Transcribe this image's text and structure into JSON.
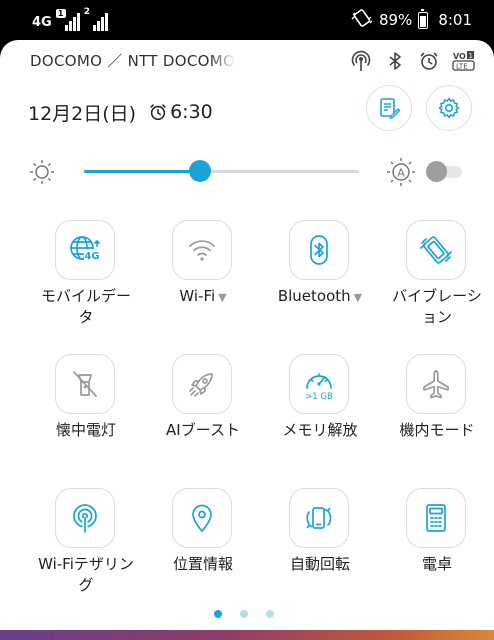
{
  "status_bar": {
    "network_label": "4G",
    "sim1_badge": "1",
    "sim2_badge": "2",
    "battery_percent": "89%",
    "time": "8:01"
  },
  "header": {
    "carrier": "DOCOMO ／ NTT DOCOMO",
    "date": "12月2日(日)",
    "alarm_time": "6:30"
  },
  "brightness": {
    "level": 0.42,
    "auto_brightness_on": false
  },
  "tiles": [
    {
      "id": "mobile-data",
      "label": "モバイルデータ",
      "icon": "globe-4g-icon",
      "active": true,
      "arrow": ""
    },
    {
      "id": "wifi",
      "label": "Wi-Fi",
      "icon": "wifi-icon",
      "active": false,
      "arrow": "▼"
    },
    {
      "id": "bluetooth",
      "label": "Bluetooth",
      "icon": "bluetooth-icon",
      "active": true,
      "arrow": "▼"
    },
    {
      "id": "vibrate",
      "label": "バイブレーション",
      "icon": "vibrate-icon",
      "active": true,
      "arrow": ""
    },
    {
      "id": "flashlight",
      "label": "懐中電灯",
      "icon": "flashlight-icon",
      "active": false,
      "arrow": ""
    },
    {
      "id": "ai-boost",
      "label": "AIブースト",
      "icon": "rocket-icon",
      "active": false,
      "arrow": ""
    },
    {
      "id": "memory-release",
      "label": "メモリ解放",
      "icon": "speedometer-icon",
      "active": true,
      "arrow": "",
      "icon_text": ">1 GB"
    },
    {
      "id": "airplane-mode",
      "label": "機内モード",
      "icon": "airplane-icon",
      "active": false,
      "arrow": ""
    },
    {
      "id": "wifi-tethering",
      "label": "Wi-Fiテザリング",
      "icon": "hotspot-icon",
      "active": true,
      "arrow": ""
    },
    {
      "id": "location",
      "label": "位置情報",
      "icon": "location-pin-icon",
      "active": true,
      "arrow": ""
    },
    {
      "id": "auto-rotate",
      "label": "自動回転",
      "icon": "rotate-icon",
      "active": true,
      "arrow": ""
    },
    {
      "id": "calculator",
      "label": "電卓",
      "icon": "calculator-icon",
      "active": true,
      "arrow": ""
    }
  ],
  "pager": {
    "count": 3,
    "current": 1
  },
  "colors": {
    "accent": "#1aa3d9",
    "inactive_icon": "#9a9a9a",
    "text": "#222222",
    "tile_border": "#dcdcdc"
  }
}
